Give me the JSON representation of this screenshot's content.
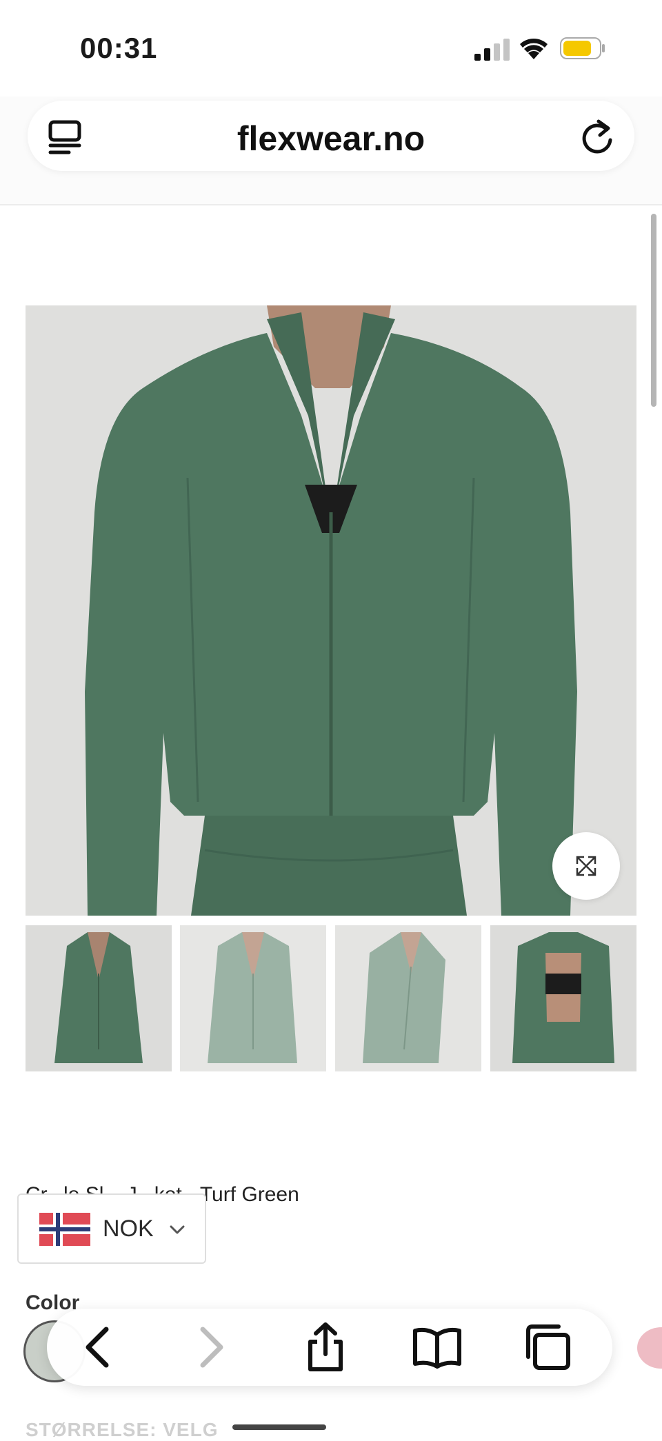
{
  "status_bar": {
    "time": "00:31"
  },
  "browser": {
    "url": "flexwear.no",
    "reader_icon": "reader-icon",
    "reload_icon": "reload-icon"
  },
  "product": {
    "title": "Cr...le Sl... J...ket - Turf Green",
    "images_count": 4,
    "main_image": "green-jacket-front",
    "thumbnails": [
      "green-jacket-front",
      "green-jacket-side-light",
      "green-jacket-angle",
      "green-jacket-open-sports-bra"
    ]
  },
  "currency": {
    "label": "NOK",
    "flag": "norway-flag"
  },
  "options": {
    "color_label": "Color",
    "size_label": "STØRRELSE: VELG"
  },
  "toolbar": {
    "items": [
      "back-icon",
      "forward-icon",
      "share-icon",
      "bookmarks-icon",
      "tabs-icon"
    ]
  },
  "colors": {
    "jacket_green": "#4f7760",
    "battery_yellow": "#f5c800",
    "flag_red": "#e04a55"
  }
}
